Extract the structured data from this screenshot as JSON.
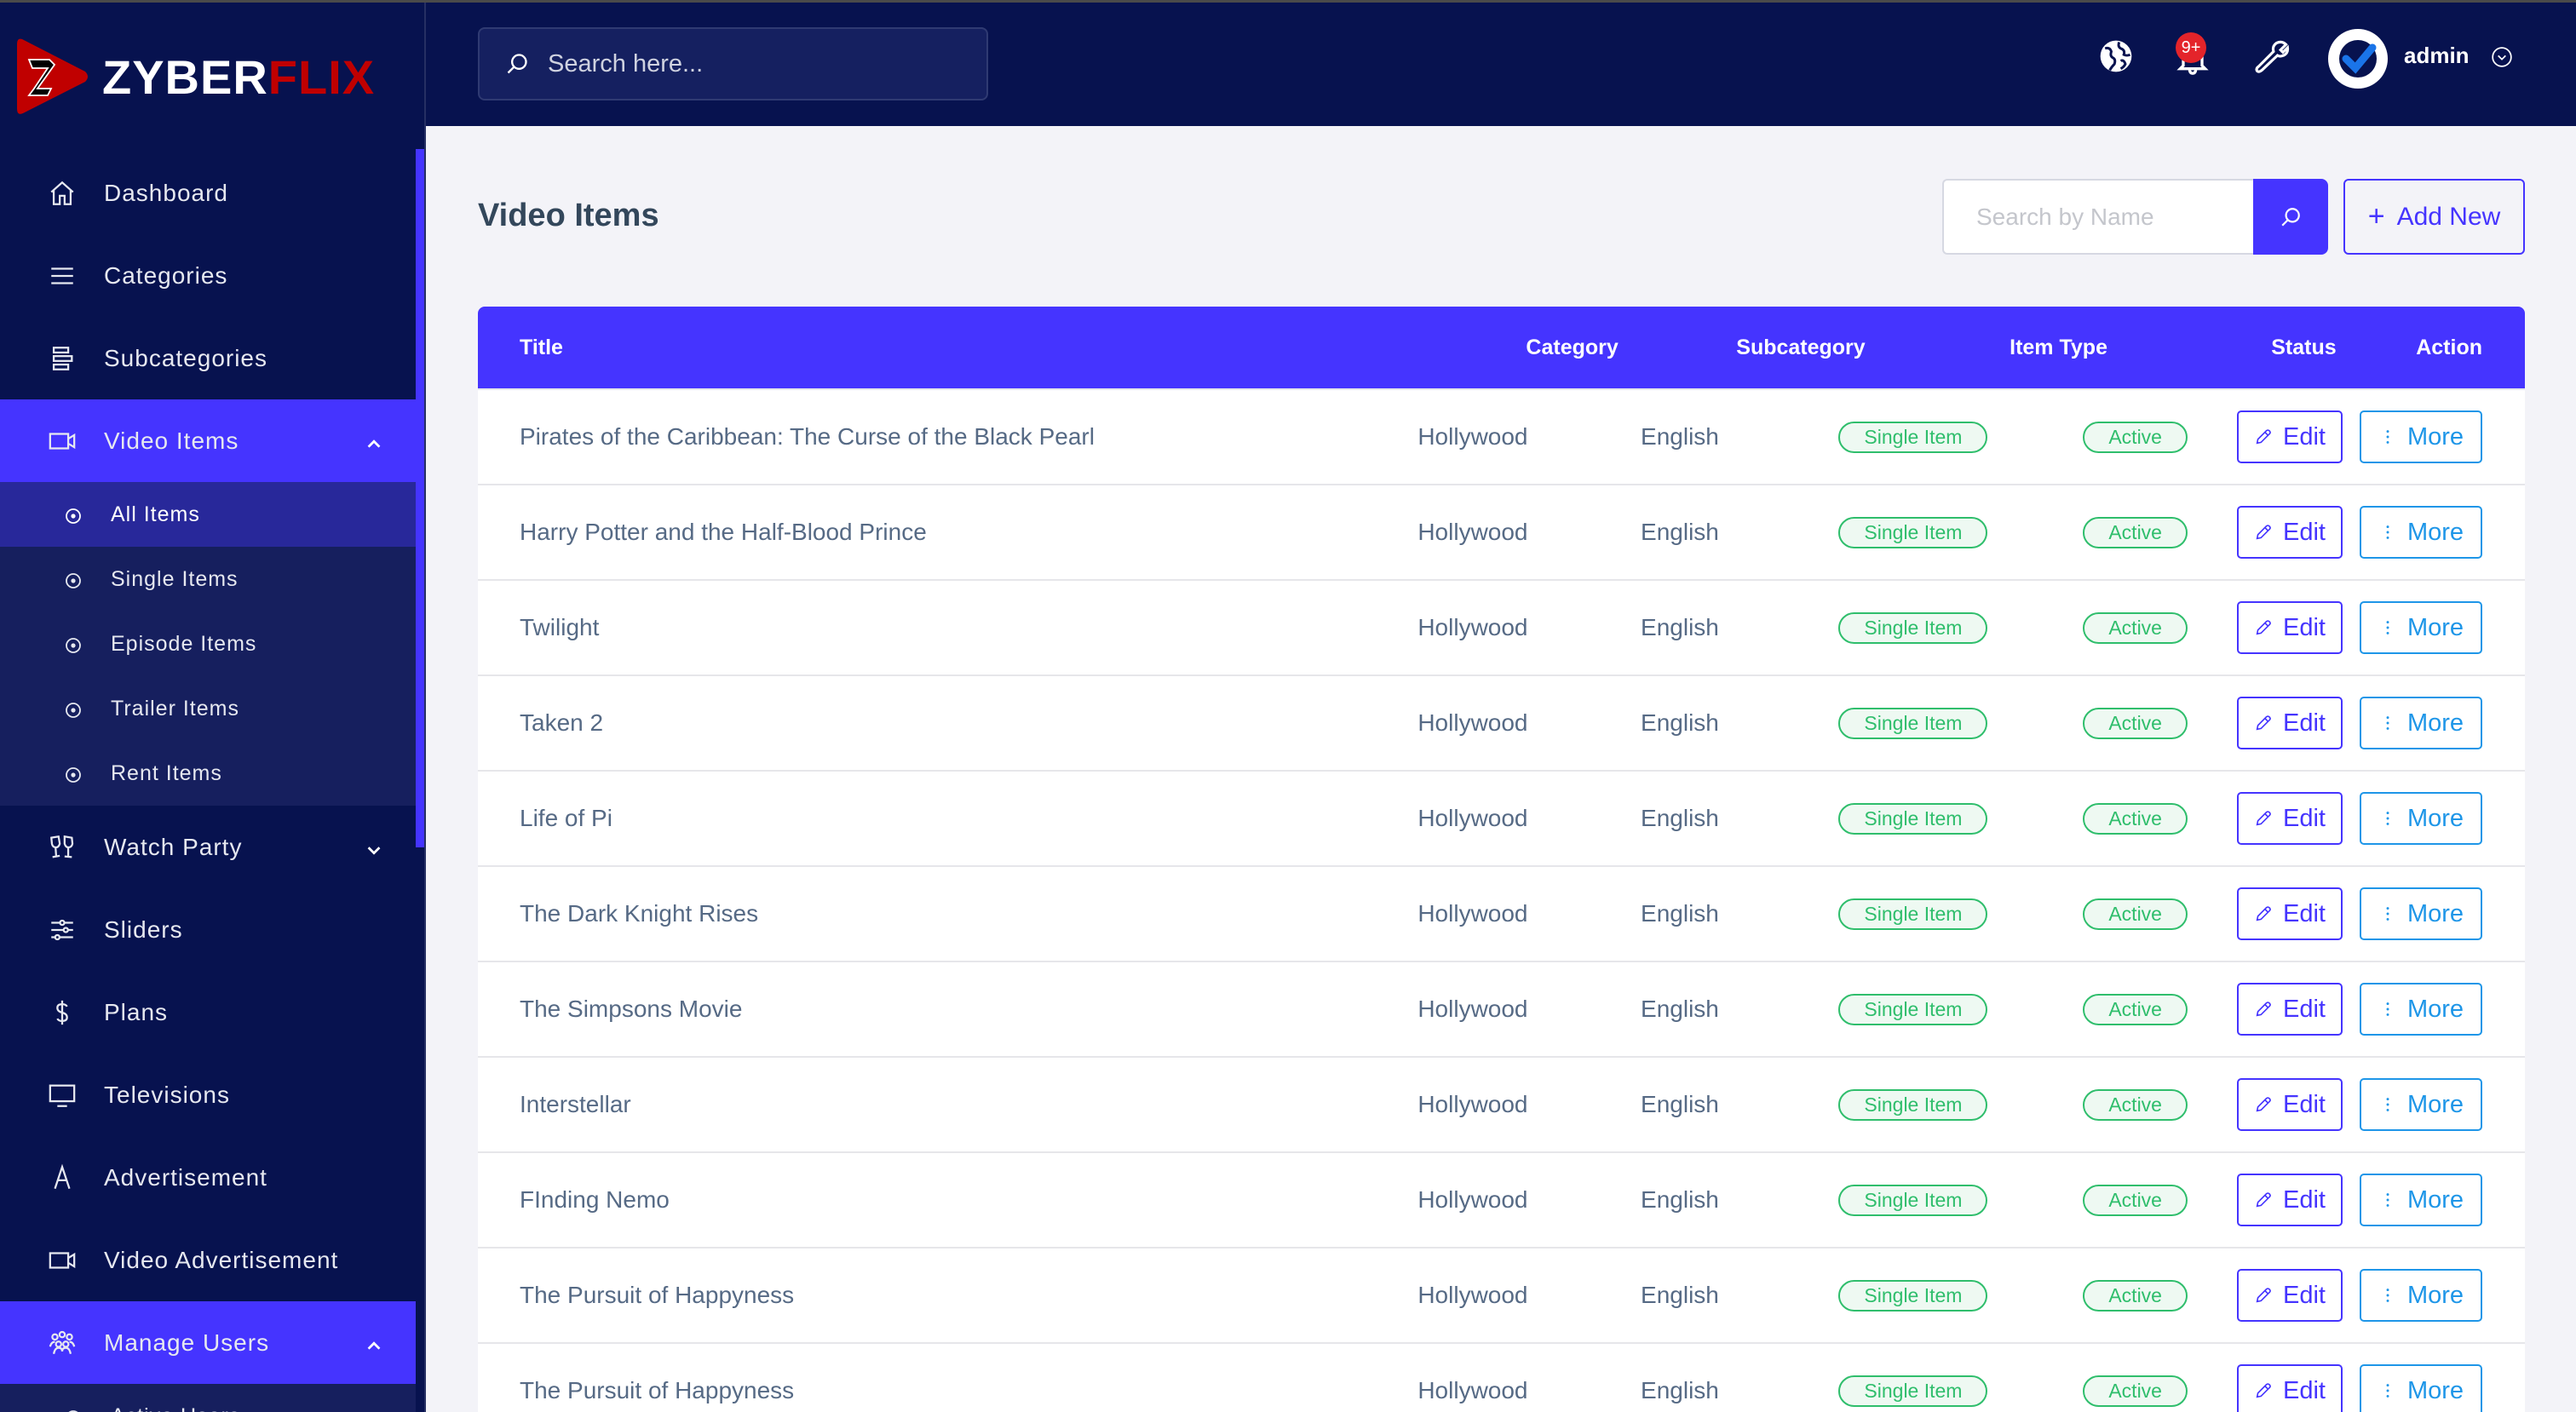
{
  "app": {
    "brand_primary": "ZYBER",
    "brand_accent": "FLIX",
    "accent_color": "#4534ff",
    "brand_red": "#c00000"
  },
  "header": {
    "search_placeholder": "Search here...",
    "notification_badge": "9+",
    "username": "admin",
    "icons": [
      "globe-icon",
      "bell-icon",
      "wrench-icon",
      "avatar",
      "chevron-down-circle-icon"
    ]
  },
  "sidebar": {
    "items": [
      {
        "label": "Dashboard",
        "icon": "home-icon"
      },
      {
        "label": "Categories",
        "icon": "menu-lines-icon"
      },
      {
        "label": "Subcategories",
        "icon": "stack-icon"
      },
      {
        "label": "Video Items",
        "icon": "video-camera-icon",
        "expanded": true,
        "active": true,
        "children": [
          {
            "label": "All Items",
            "current": true
          },
          {
            "label": "Single Items"
          },
          {
            "label": "Episode Items"
          },
          {
            "label": "Trailer Items"
          },
          {
            "label": "Rent Items"
          }
        ]
      },
      {
        "label": "Watch Party",
        "icon": "glasses-cheers-icon",
        "expanded": false
      },
      {
        "label": "Sliders",
        "icon": "sliders-icon"
      },
      {
        "label": "Plans",
        "icon": "dollar-icon"
      },
      {
        "label": "Televisions",
        "icon": "monitor-icon"
      },
      {
        "label": "Advertisement",
        "icon": "letter-a-icon"
      },
      {
        "label": "Video Advertisement",
        "icon": "video-camera-icon"
      },
      {
        "label": "Manage Users",
        "icon": "users-group-icon",
        "expanded": true,
        "active": true,
        "children": [
          {
            "label": "Active Users"
          }
        ]
      }
    ]
  },
  "main": {
    "title": "Video Items",
    "search_placeholder": "Search by Name",
    "add_new_label": "Add New",
    "table": {
      "columns": [
        "Title",
        "Category",
        "Subcategory",
        "Item Type",
        "Status",
        "Action"
      ],
      "edit_label": "Edit",
      "more_label": "More",
      "rows": [
        {
          "title": "Pirates of the Caribbean: The Curse of the Black Pearl",
          "category": "Hollywood",
          "subcategory": "English",
          "item_type": "Single Item",
          "status": "Active"
        },
        {
          "title": "Harry Potter and the Half-Blood Prince",
          "category": "Hollywood",
          "subcategory": "English",
          "item_type": "Single Item",
          "status": "Active"
        },
        {
          "title": "Twilight",
          "category": "Hollywood",
          "subcategory": "English",
          "item_type": "Single Item",
          "status": "Active"
        },
        {
          "title": "Taken 2",
          "category": "Hollywood",
          "subcategory": "English",
          "item_type": "Single Item",
          "status": "Active"
        },
        {
          "title": "Life of Pi",
          "category": "Hollywood",
          "subcategory": "English",
          "item_type": "Single Item",
          "status": "Active"
        },
        {
          "title": "The Dark Knight Rises",
          "category": "Hollywood",
          "subcategory": "English",
          "item_type": "Single Item",
          "status": "Active"
        },
        {
          "title": "The Simpsons Movie",
          "category": "Hollywood",
          "subcategory": "English",
          "item_type": "Single Item",
          "status": "Active"
        },
        {
          "title": "Interstellar",
          "category": "Hollywood",
          "subcategory": "English",
          "item_type": "Single Item",
          "status": "Active"
        },
        {
          "title": "FInding Nemo",
          "category": "Hollywood",
          "subcategory": "English",
          "item_type": "Single Item",
          "status": "Active"
        },
        {
          "title": "The Pursuit of Happyness",
          "category": "Hollywood",
          "subcategory": "English",
          "item_type": "Single Item",
          "status": "Active"
        },
        {
          "title": "The Pursuit of Happyness",
          "category": "Hollywood",
          "subcategory": "English",
          "item_type": "Single Item",
          "status": "Active"
        }
      ]
    }
  }
}
